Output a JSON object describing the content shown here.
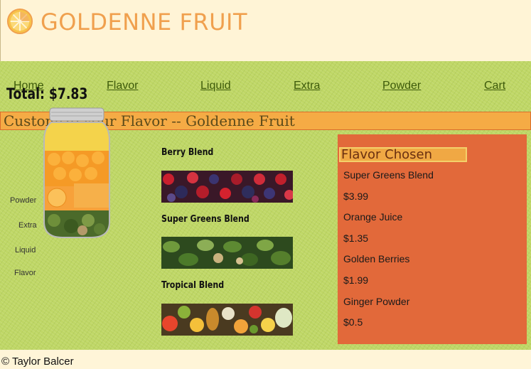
{
  "header": {
    "brand": "GOLDENNE FRUIT",
    "icon": "orange-slice-icon"
  },
  "nav": {
    "items": [
      "Home",
      "Flavor",
      "Liquid",
      "Extra",
      "Powder",
      "Cart"
    ]
  },
  "page_title": "Customize your Flavor -- Goldenne Fruit",
  "total": "Total: $7.83",
  "jar": {
    "layers": [
      "Powder",
      "Extra",
      "Liquid",
      "Flavor"
    ]
  },
  "blends": [
    {
      "name": "Berry Blend"
    },
    {
      "name": "Super Greens Blend"
    },
    {
      "name": "Tropical Blend"
    }
  ],
  "panel": {
    "title": "Flavor Chosen",
    "items": [
      "Super Greens Blend",
      "$3.99",
      "Orange Juice",
      "$1.35",
      "Golden Berries",
      "$1.99",
      "Ginger Powder",
      "$0.5"
    ]
  },
  "footer": "© Taylor Balcer",
  "colors": {
    "accent": "#f0a04e",
    "panel": "#e2693a",
    "green": "#bfd766",
    "title_bar": "#f5ab45"
  }
}
